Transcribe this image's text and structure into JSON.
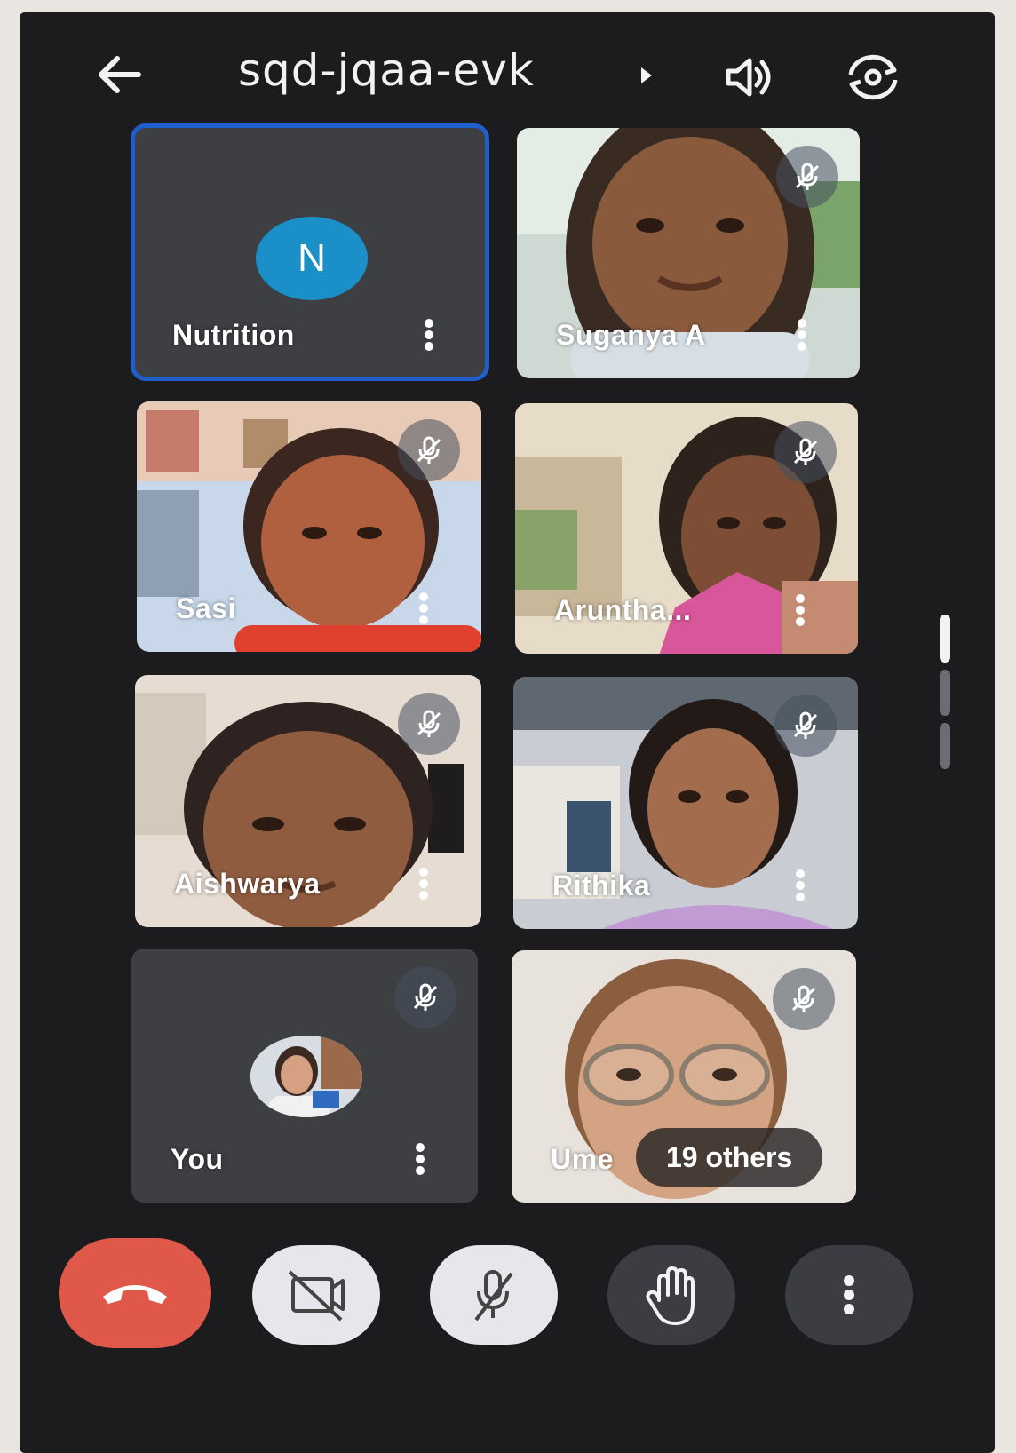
{
  "header": {
    "meeting_code": "sqd-jqaa-evk",
    "icons": [
      "back-arrow-icon",
      "speaker-icon",
      "switch-camera-icon"
    ]
  },
  "participants": [
    {
      "name": "Nutrition",
      "avatar_letter": "N",
      "video": false,
      "active_speaker": true
    },
    {
      "name": "Suganya A",
      "video": true,
      "muted": true
    },
    {
      "name": "Sasi",
      "video": true,
      "muted": true
    },
    {
      "name": "Aruntha...",
      "video": true,
      "muted": true
    },
    {
      "name": "Aishwarya",
      "video": true,
      "muted": true
    },
    {
      "name": "Rithika",
      "video": true,
      "muted": true
    },
    {
      "name": "You",
      "video": false,
      "muted": true
    },
    {
      "name": "Ume",
      "video": true,
      "muted": true
    }
  ],
  "others_pill": "19 others",
  "controls": [
    {
      "name": "leave-call-button",
      "icon": "end-call-icon",
      "color": "#e0584a"
    },
    {
      "name": "camera-toggle-button",
      "icon": "camera-off-icon",
      "color": "#e7e6ea"
    },
    {
      "name": "mic-toggle-button",
      "icon": "mic-off-icon",
      "color": "#e7e6ea"
    },
    {
      "name": "raise-hand-button",
      "icon": "hand-icon",
      "color": "#3b3d42"
    },
    {
      "name": "more-options-button",
      "icon": "more-vert-icon",
      "color": "#3b3d42"
    }
  ],
  "colors": {
    "background": "#1c1b1d",
    "tile_dark": "#3d3f43",
    "active_outline": "#1f5fcc",
    "avatar": "#1b8fc7"
  }
}
